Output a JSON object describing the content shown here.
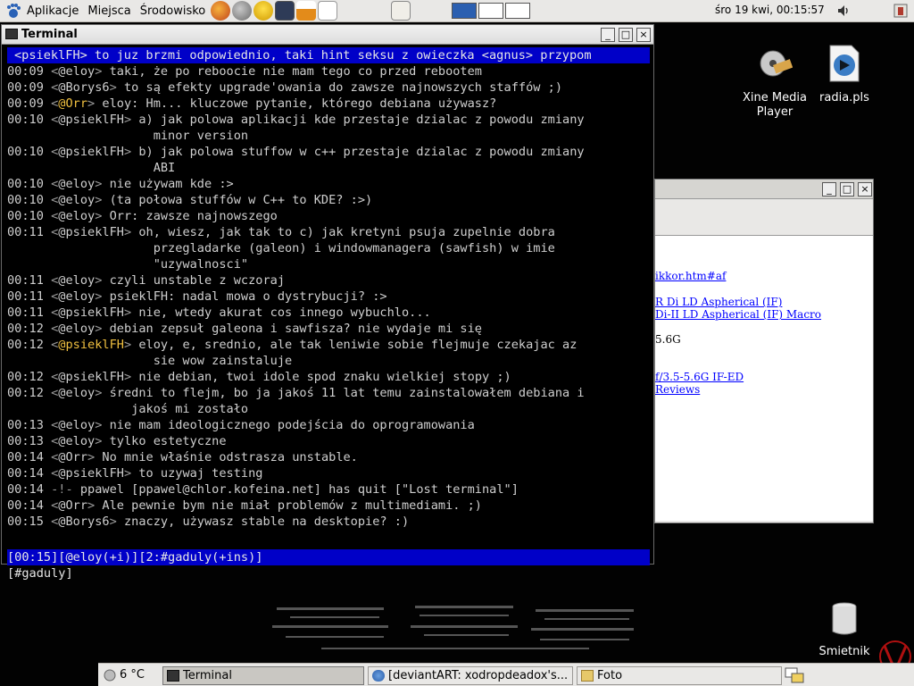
{
  "top_panel": {
    "menus": [
      "Aplikacje",
      "Miejsca",
      "Środowisko"
    ],
    "clock": "śro 19 kwi, 00:15:57"
  },
  "desktop_icons": [
    {
      "label_line1": "Xine Media",
      "label_line2": "Player"
    },
    {
      "label_line1": "radia.pls",
      "label_line2": ""
    },
    {
      "label_line1": "Smietnik",
      "label_line2": ""
    }
  ],
  "browser_fragment": {
    "lines": [
      "ikkor.htm#af",
      "R Di LD Aspherical (IF)",
      " Di-II LD Aspherical (IF) Macro",
      "5.6G",
      "f/3.5-5.6G IF-ED",
      "  Reviews"
    ]
  },
  "terminal": {
    "title": "Terminal",
    "topic": "<psieklFH> to juz brzmi odpowiednio, taki hint seksu z owieczka <agnus> przypom",
    "lines": [
      {
        "time": "00:09",
        "nick": "@eloy",
        "text": "taki, że po reboocie nie mam tego co przed rebootem"
      },
      {
        "time": "00:09",
        "nick": "@Borys6",
        "text": "to są efekty upgrade'owania do zawsze najnowszych staffów ;)"
      },
      {
        "time": "00:09",
        "nick": "@Orr",
        "text": "eloy: Hm... kluczowe pytanie, którego debiana używasz?"
      },
      {
        "time": "00:10",
        "nick": "@psieklFH",
        "text": "a) jak polowa aplikacji kde przestaje dzialac z powodu zmiany"
      },
      {
        "time": "",
        "nick": "",
        "text": "minor version"
      },
      {
        "time": "00:10",
        "nick": "@psieklFH",
        "text": "b) jak polowa stuffow w c++ przestaje dzialac z powodu zmiany"
      },
      {
        "time": "",
        "nick": "",
        "text": "ABI"
      },
      {
        "time": "00:10",
        "nick": "@eloy",
        "text": "nie używam kde :>"
      },
      {
        "time": "00:10",
        "nick": "@eloy",
        "text": "(ta połowa stuffów w C++ to KDE? :>)"
      },
      {
        "time": "00:10",
        "nick": "@eloy",
        "text": "Orr: zawsze najnowszego"
      },
      {
        "time": "00:11",
        "nick": "@psieklFH",
        "text": "oh, wiesz, jak tak to c) jak kretyni psuja zupelnie dobra"
      },
      {
        "time": "",
        "nick": "",
        "text": "przegladarke (galeon) i windowmanagera (sawfish) w imie"
      },
      {
        "time": "",
        "nick": "",
        "text": "\"uzywalnosci\""
      },
      {
        "time": "00:11",
        "nick": "@eloy",
        "text": "czyli unstable z wczoraj"
      },
      {
        "time": "00:11",
        "nick": "@eloy",
        "text": "psieklFH: nadal mowa o dystrybucji? :>"
      },
      {
        "time": "00:11",
        "nick": "@psieklFH",
        "text": "nie, wtedy akurat cos innego wybuchlo..."
      },
      {
        "time": "00:12",
        "nick": "@eloy",
        "text": "debian zepsuł galeona i sawfisza? nie wydaje mi się"
      },
      {
        "time": "00:12",
        "nick": "@psieklFH",
        "text": "eloy, e, srednio, ale tak leniwie sobie flejmuje czekajac az"
      },
      {
        "time": "",
        "nick": "",
        "text": "sie wow zainstaluje"
      },
      {
        "time": "00:12",
        "nick": "@psieklFH",
        "text": "nie debian, twoi idole spod znaku wielkiej stopy ;)"
      },
      {
        "time": "00:12",
        "nick": "@eloy",
        "text": "średni to flejm, bo ja jakoś 11 lat temu zainstalowałem debiana i"
      },
      {
        "time": "",
        "nick": "",
        "text": "jakoś mi zostało"
      },
      {
        "time": "00:13",
        "nick": "@eloy",
        "text": "nie mam ideologicznego podejścia do oprogramowania"
      },
      {
        "time": "00:13",
        "nick": "@eloy",
        "text": "tylko estetyczne"
      },
      {
        "time": "00:14",
        "nick": "@Orr",
        "text": "No mnie właśnie odstrasza unstable."
      },
      {
        "time": "00:14",
        "nick": "@psieklFH",
        "text": "to uzywaj testing"
      },
      {
        "time": "00:14",
        "nick": "-!-",
        "text": "ppawel [ppawel@chlor.kofeina.net] has quit [\"Lost terminal\"]"
      },
      {
        "time": "00:14",
        "nick": "@Orr",
        "text": "Ale pewnie bym nie miał problemów z multimediami. ;)"
      },
      {
        "time": "00:15",
        "nick": "@Borys6",
        "text": "znaczy, używasz stable na desktopie? :)"
      }
    ],
    "status_bar": "[00:15][@eloy(+i)][2:#gaduly(+ins)]",
    "prompt": "[#gaduly]"
  },
  "taskbar": {
    "weather": "6 °C",
    "tasks": [
      "Terminal",
      "[deviantART: xodropdeadox's...",
      "Foto"
    ]
  }
}
